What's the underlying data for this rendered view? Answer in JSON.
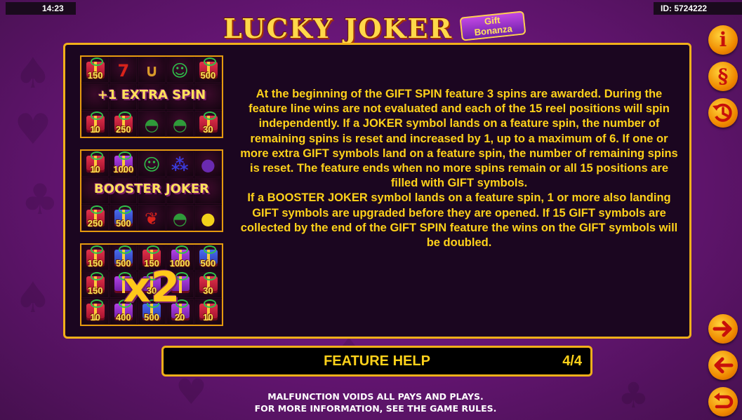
{
  "status_bar": {
    "time": "14:23",
    "game_id": "ID: 5724222"
  },
  "logo": {
    "title": "LUCKY JOKER",
    "subtitle_line1": "Gift",
    "subtitle_line2": "Bonanza"
  },
  "thumbnails": [
    {
      "overlay": "+1 EXTRA SPIN",
      "cells": [
        {
          "type": "gift",
          "color": "red",
          "value": "150"
        },
        {
          "type": "seven",
          "value": ""
        },
        {
          "type": "horseshoe",
          "value": ""
        },
        {
          "type": "joker",
          "value": ""
        },
        {
          "type": "gift",
          "color": "red",
          "value": "500"
        },
        {
          "type": "blank",
          "value": ""
        },
        {
          "type": "blank",
          "value": ""
        },
        {
          "type": "blank",
          "value": ""
        },
        {
          "type": "blank",
          "value": ""
        },
        {
          "type": "blank",
          "value": ""
        },
        {
          "type": "gift",
          "color": "red",
          "value": "10"
        },
        {
          "type": "gift",
          "color": "red",
          "value": "250"
        },
        {
          "type": "watermelon",
          "value": ""
        },
        {
          "type": "watermelon",
          "value": ""
        },
        {
          "type": "gift",
          "color": "red",
          "value": "30"
        }
      ]
    },
    {
      "overlay": "BOOSTER JOKER",
      "cells": [
        {
          "type": "gift",
          "color": "red",
          "value": "10"
        },
        {
          "type": "gift",
          "color": "purple",
          "value": "1000"
        },
        {
          "type": "joker",
          "value": ""
        },
        {
          "type": "grapes",
          "value": ""
        },
        {
          "type": "plum",
          "value": ""
        },
        {
          "type": "blank",
          "value": ""
        },
        {
          "type": "blank",
          "value": ""
        },
        {
          "type": "blank",
          "value": ""
        },
        {
          "type": "blank",
          "value": ""
        },
        {
          "type": "blank",
          "value": ""
        },
        {
          "type": "gift",
          "color": "red",
          "value": "250"
        },
        {
          "type": "gift",
          "color": "blue",
          "value": "500"
        },
        {
          "type": "cherry",
          "value": ""
        },
        {
          "type": "watermelon",
          "value": ""
        },
        {
          "type": "lemon",
          "value": ""
        }
      ]
    },
    {
      "overlay": "x2",
      "cells": [
        {
          "type": "gift",
          "color": "red",
          "value": "150"
        },
        {
          "type": "gift",
          "color": "blue",
          "value": "500"
        },
        {
          "type": "gift",
          "color": "red",
          "value": "150"
        },
        {
          "type": "gift",
          "color": "purple",
          "value": "1000"
        },
        {
          "type": "gift",
          "color": "blue",
          "value": "500"
        },
        {
          "type": "gift",
          "color": "red",
          "value": "150"
        },
        {
          "type": "gift",
          "color": "purple",
          "value": ""
        },
        {
          "type": "gift",
          "color": "purple",
          "value": "30"
        },
        {
          "type": "gift",
          "color": "purple",
          "value": ""
        },
        {
          "type": "gift",
          "color": "red",
          "value": "30"
        },
        {
          "type": "gift",
          "color": "red",
          "value": "10"
        },
        {
          "type": "gift",
          "color": "purple",
          "value": "400"
        },
        {
          "type": "gift",
          "color": "blue",
          "value": "500"
        },
        {
          "type": "gift",
          "color": "purple",
          "value": "20"
        },
        {
          "type": "gift",
          "color": "red",
          "value": "10"
        }
      ]
    }
  ],
  "description": {
    "paragraph1": "At the beginning of the GIFT SPIN feature 3 spins are awarded. During the feature line wins are not evaluated and each of the 15 reel positions will spin independently. If a JOKER symbol lands on a feature spin, the number of remaining spins is reset and increased by 1, up to a maximum of 6. If one or more extra GIFT symbols land on a feature spin, the number of remaining spins is reset. The feature ends when no more spins remain or all 15 positions are filled with GIFT symbols.",
    "paragraph2": "If a BOOSTER JOKER symbol lands on a feature spin, 1 or more also landing GIFT symbols are upgraded before they are opened. If 15 GIFT symbols are collected by the end of the GIFT SPIN feature the wins on the GIFT symbols will be doubled."
  },
  "footer": {
    "title": "FEATURE HELP",
    "page": "4/4"
  },
  "disclaimer": {
    "line1": "MALFUNCTION VOIDS ALL PAYS AND PLAYS.",
    "line2": "FOR MORE INFORMATION, SEE THE GAME RULES."
  },
  "right_buttons": {
    "info": "i",
    "rules": "§",
    "history": "history-icon",
    "next": "arrow-right-icon",
    "prev": "arrow-left-icon",
    "back": "return-icon"
  },
  "colors": {
    "accent": "#f2b01a",
    "text_gold": "#ffd21a",
    "background": "#6a1679",
    "button_orange": "#f08a00"
  }
}
